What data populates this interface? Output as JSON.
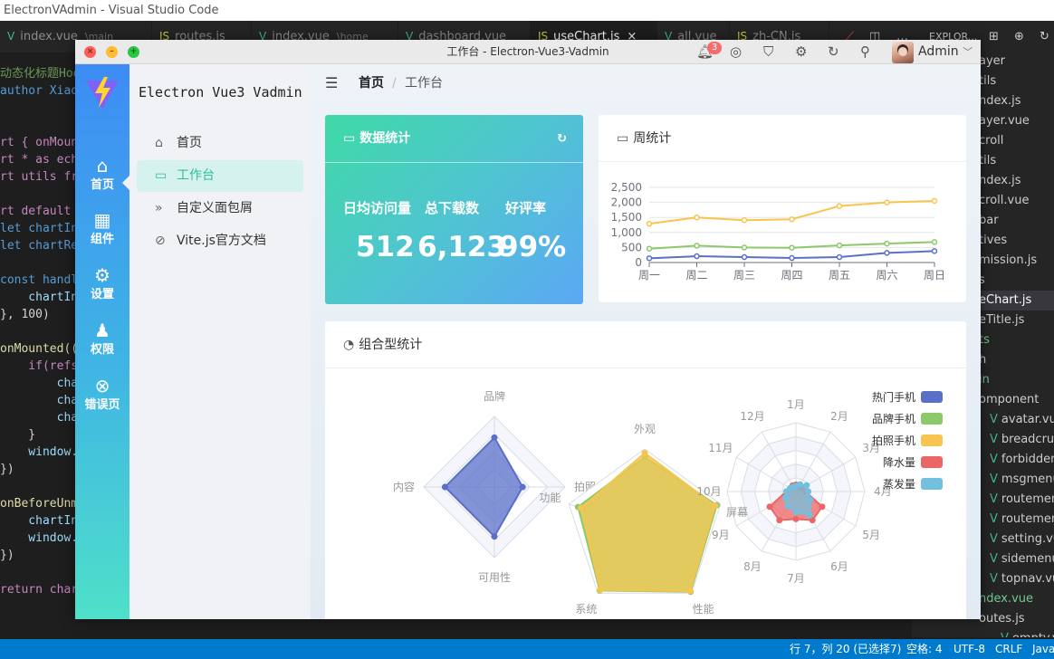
{
  "vscode": {
    "window_title": "ElectronVAdmin - Visual Studio Code",
    "tabs": [
      {
        "icon": "vue-icon",
        "glyph": "V",
        "label": "index.vue",
        "path": "\\main"
      },
      {
        "icon": "js-icon",
        "glyph": "JS",
        "label": "routes.js",
        "path": ""
      },
      {
        "icon": "vue-icon",
        "glyph": "V",
        "label": "index.vue",
        "path": "\\home"
      },
      {
        "icon": "vue-icon",
        "glyph": "V",
        "label": "dashboard.vue",
        "path": ""
      },
      {
        "icon": "js-icon",
        "glyph": "JS",
        "label": "useChart.js",
        "path": "",
        "active": true
      },
      {
        "icon": "vue-icon",
        "glyph": "V",
        "label": "all.vue",
        "path": ""
      },
      {
        "icon": "js-icon",
        "glyph": "JS",
        "label": "zh-CN.js",
        "path": ""
      }
    ],
    "explorer_label": "EXPLOR...",
    "code_lines": [
      {
        "text": "动态化标题Hoo",
        "color": "#6a9955"
      },
      {
        "text": "author Xiao",
        "color": "#569cd6"
      },
      {
        "text": "",
        "color": "#d4d4d4"
      },
      {
        "text": "",
        "color": "#d4d4d4"
      },
      {
        "text": "rt { onMoun",
        "color": "#c586c0"
      },
      {
        "text": "rt * as ech",
        "color": "#c586c0"
      },
      {
        "text": "rt utils fr",
        "color": "#c586c0"
      },
      {
        "text": "",
        "color": "#d4d4d4"
      },
      {
        "text": "rt default ",
        "color": "#c586c0"
      },
      {
        "text": "let chartIn",
        "color": "#569cd6"
      },
      {
        "text": "let chartRe",
        "color": "#569cd6"
      },
      {
        "text": "",
        "color": "#d4d4d4"
      },
      {
        "text": "const handl",
        "color": "#569cd6"
      },
      {
        "text": "    chartIn",
        "color": "#9cdcfe"
      },
      {
        "text": "}, 100)",
        "color": "#d4d4d4"
      },
      {
        "text": "",
        "color": "#d4d4d4"
      },
      {
        "text": "onMounted((",
        "color": "#dcdcaa"
      },
      {
        "text": "    if(refs",
        "color": "#c586c0"
      },
      {
        "text": "        cha",
        "color": "#9cdcfe"
      },
      {
        "text": "        cha",
        "color": "#9cdcfe"
      },
      {
        "text": "        cha",
        "color": "#9cdcfe"
      },
      {
        "text": "    }",
        "color": "#d4d4d4"
      },
      {
        "text": "    window.",
        "color": "#9cdcfe"
      },
      {
        "text": "})",
        "color": "#d4d4d4"
      },
      {
        "text": "",
        "color": "#d4d4d4"
      },
      {
        "text": "onBeforeUnm",
        "color": "#dcdcaa"
      },
      {
        "text": "    chartIn",
        "color": "#9cdcfe"
      },
      {
        "text": "    window.",
        "color": "#9cdcfe"
      },
      {
        "text": "})",
        "color": "#d4d4d4"
      },
      {
        "text": "",
        "color": "#d4d4d4"
      },
      {
        "text": "return char",
        "color": "#c586c0"
      }
    ],
    "explorer_items": [
      {
        "label": "ayer",
        "color": "#cccccc",
        "indent": 0
      },
      {
        "label": "tils",
        "color": "#cccccc",
        "indent": 0
      },
      {
        "label": "ndex.js",
        "color": "#cccccc",
        "indent": 0
      },
      {
        "label": "ayer.vue",
        "color": "#cccccc",
        "indent": 0
      },
      {
        "label": "croll",
        "color": "#cccccc",
        "indent": 0
      },
      {
        "label": "tils",
        "color": "#cccccc",
        "indent": 0
      },
      {
        "label": "ndex.js",
        "color": "#cccccc",
        "indent": 0
      },
      {
        "label": "croll.vue",
        "color": "#cccccc",
        "indent": 0
      },
      {
        "label": "bar",
        "color": "#cccccc",
        "indent": 0
      },
      {
        "label": "tives",
        "color": "#cccccc",
        "indent": 0
      },
      {
        "label": "mission.js",
        "color": "#cccccc",
        "indent": 0
      },
      {
        "label": "s",
        "color": "#cccccc",
        "indent": 0
      },
      {
        "label": "eChart.js",
        "color": "#ffffff",
        "indent": 0,
        "selected": true
      },
      {
        "label": "eTitle.js",
        "color": "#cccccc",
        "indent": 0
      },
      {
        "label": "ts",
        "color": "#73c991",
        "indent": 0
      },
      {
        "label": "h",
        "color": "#cccccc",
        "indent": 0
      },
      {
        "label": "in",
        "color": "#73c991",
        "indent": 0
      },
      {
        "label": "omponent",
        "color": "#cccccc",
        "indent": 0
      },
      {
        "label": "avatar.vue",
        "color": "#cccccc",
        "indent": 1
      },
      {
        "label": "breadcrumb.vue",
        "color": "#cccccc",
        "indent": 1
      },
      {
        "label": "forbidden.vue",
        "color": "#cccccc",
        "indent": 1
      },
      {
        "label": "msgmenu.vue",
        "color": "#cccccc",
        "indent": 1
      },
      {
        "label": "routemenu.vue",
        "color": "#cccccc",
        "indent": 1
      },
      {
        "label": "routemenuItem",
        "color": "#cccccc",
        "indent": 1
      },
      {
        "label": "setting.vue",
        "color": "#cccccc",
        "indent": 1
      },
      {
        "label": "sidemenu.vue",
        "color": "#cccccc",
        "indent": 1
      },
      {
        "label": "topnav.vue",
        "color": "#cccccc",
        "indent": 1
      },
      {
        "label": "ndex.vue",
        "color": "#73c991",
        "indent": 0
      },
      {
        "label": "outes.js",
        "color": "#cccccc",
        "indent": 0
      },
      {
        "label": "empty.vue",
        "color": "#cccccc",
        "indent": 2
      }
    ],
    "status": {
      "position": "行 7，列 20 (已选择7)",
      "spaces": "空格: 4",
      "encoding": "UTF-8",
      "eol": "CRLF",
      "language": "Java"
    }
  },
  "app": {
    "window_title": "工作台 - Electron-Vue3-Vadmin",
    "notify_count": "3",
    "user_name": "Admin",
    "brand": "Electron Vue3 Vadmin",
    "nav": [
      {
        "icon": "home-icon",
        "glyph": "⌂",
        "label": "首页",
        "active": true
      },
      {
        "icon": "grid-icon",
        "glyph": "▦",
        "label": "组件"
      },
      {
        "icon": "gear-icon",
        "glyph": "⚙",
        "label": "设置"
      },
      {
        "icon": "user-icon",
        "glyph": "♟",
        "label": "权限"
      },
      {
        "icon": "error-icon",
        "glyph": "⊗",
        "label": "错误页"
      }
    ],
    "menu": [
      {
        "icon": "home-outline-icon",
        "glyph": "⌂",
        "label": "首页"
      },
      {
        "icon": "monitor-icon",
        "glyph": "▭",
        "label": "工作台",
        "active": true
      },
      {
        "icon": "double-chevron-icon",
        "glyph": "»",
        "label": "自定义面包屑"
      },
      {
        "icon": "link-icon",
        "glyph": "⊘",
        "label": "Vite.js官方文档"
      }
    ],
    "breadcrumb": {
      "home": "首页",
      "separator": "/",
      "current": "工作台"
    },
    "stat_card": {
      "title": "数据统计",
      "items": [
        {
          "label": "日均访问量",
          "value": "512"
        },
        {
          "label": "总下载数",
          "value": "6,123"
        },
        {
          "label": "好评率",
          "value": "99%"
        }
      ]
    },
    "week_card": {
      "title": "周统计"
    },
    "combo_card": {
      "title": "组合型统计"
    }
  },
  "colors": {
    "accent": "#2dbf96",
    "nav_top": "#3d8cf5",
    "nav_bottom": "#4fe0c9"
  },
  "chart_data": [
    {
      "type": "line",
      "title": "周统计",
      "categories": [
        "周一",
        "周二",
        "周三",
        "周四",
        "周五",
        "周六",
        "周日"
      ],
      "ylim": [
        0,
        2500
      ],
      "yticks": [
        0,
        500,
        1000,
        1500,
        2000,
        2500
      ],
      "ytick_labels": [
        "0",
        "500",
        "1,000",
        "1,500",
        "2,000",
        "2,500"
      ],
      "series": [
        {
          "color": "#f7c54f",
          "values": [
            1290,
            1500,
            1410,
            1440,
            1880,
            2000,
            2050
          ]
        },
        {
          "color": "#8bc96b",
          "values": [
            460,
            560,
            500,
            490,
            570,
            630,
            680
          ]
        },
        {
          "color": "#5a6fc8",
          "values": [
            140,
            210,
            180,
            150,
            180,
            320,
            380
          ]
        }
      ],
      "grid": true
    },
    {
      "type": "radar",
      "indicators": [
        "品牌",
        "拍照",
        "可用性",
        "内容"
      ],
      "max": 100,
      "series": [
        {
          "color": "#5a6fc8",
          "values": [
            70,
            40,
            70,
            70
          ]
        }
      ]
    },
    {
      "type": "radar",
      "indicators": [
        "外观",
        "拍照",
        "性能",
        "系统",
        "功能"
      ],
      "max": 100,
      "series": [
        {
          "color": "#8bc96b",
          "values": [
            90,
            95,
            98,
            96,
            88
          ]
        },
        {
          "color": "#f7c54f",
          "values": [
            95,
            93,
            97,
            95,
            84
          ]
        }
      ]
    },
    {
      "type": "polar-radar",
      "indicators": [
        "1月",
        "2月",
        "3月",
        "4月",
        "5月",
        "6月",
        "7月",
        "8月",
        "9月",
        "10月",
        "11月",
        "12月"
      ],
      "overlay_indicator": "屏幕",
      "max": 100,
      "legend": [
        "热门手机",
        "品牌手机",
        "拍照手机",
        "降水量",
        "蒸发量"
      ],
      "legend_position": "right",
      "series": [
        {
          "name": "降水量",
          "color": "#ec6666",
          "values": [
            10,
            8,
            10,
            14,
            44,
            48,
            40,
            48,
            44,
            14,
            8,
            10
          ]
        },
        {
          "name": "蒸发量",
          "color": "#73c0de",
          "values": [
            8,
            12,
            18,
            18,
            24,
            40,
            30,
            24,
            18,
            14,
            10,
            8
          ]
        }
      ],
      "legend_colors": [
        "#5a6fc8",
        "#8bc96b",
        "#f7c54f",
        "#ec6666",
        "#73c0de"
      ]
    }
  ]
}
